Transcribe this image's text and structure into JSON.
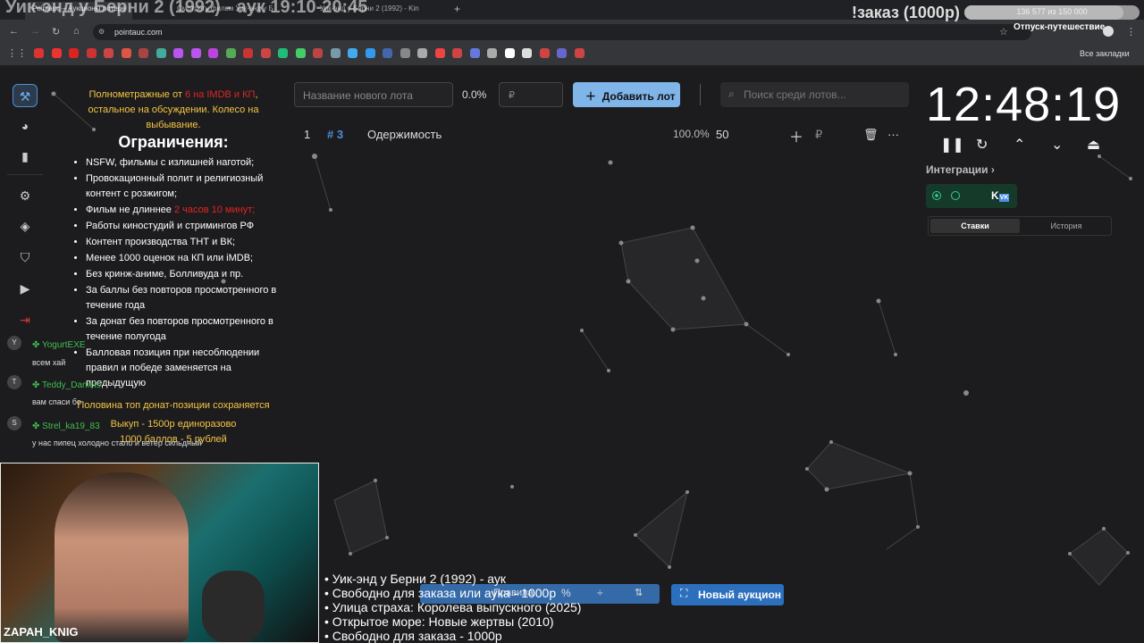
{
  "overlay": {
    "title": "Уик-энд у Берни 2 (1992) - аук 19:10-20:45",
    "order": "!заказ (1000р)",
    "progress": "136 577 из 150 000",
    "progress_fraction": 0.91,
    "vacation": "Отпуск-путешествие"
  },
  "browser": {
    "tabs": [
      "Pointauc – Аукционы лотере",
      "Смотреть фильм Уик-энд у Б",
      "Уик-энд у Берни 2 (1992) - Kin"
    ],
    "url": "pointauc.com",
    "all_bookmarks": "Все закладки",
    "bookmark_colors": [
      "#d33",
      "#e33",
      "#d22",
      "#c33",
      "#c44",
      "#d54",
      "#a44",
      "#4a9",
      "#b5e",
      "#b5e",
      "#b4d",
      "#5a5",
      "#c33",
      "#c44",
      "#2b7",
      "#4c6",
      "#b44",
      "#79a",
      "#4ae",
      "#39e",
      "#46a",
      "#888",
      "#aaa",
      "#e44",
      "#c44",
      "#67d",
      "#aaa",
      "#fff",
      "#ddd",
      "#c44",
      "#66c",
      "#c44"
    ]
  },
  "rules": {
    "note_prefix": "Полнометражные от ",
    "note_red": "6 на IMDB и КП",
    "note_suffix": ", остальное на обсуждении. Колесо на выбывание.",
    "heading": "Ограничения:",
    "items": [
      "NSFW, фильмы с излишней наготой;",
      "Провокационный полит и религиозный контент с розжигом;",
      "Фильм не длиннее ",
      "Работы киностудий и стримингов РФ",
      "Контент производства ТНТ и ВК;",
      "Менее 1000 оценок на КП или iMDB;",
      "Без кринж-аниме, Болливуда и пр.",
      "За баллы без повторов просмотренного в течение года",
      "За донат без повторов просмотренного в течение полугода",
      "Балловая позиция при несоблюдении правил и победе заменяется на предыдущую"
    ],
    "item3_red": "2 часов 10 минут;",
    "footer1": "Половина топ донат-позиции сохраняется",
    "footer2": "Выкуп - 1500р единоразово",
    "footer3": "1000 баллов - 5 рублей"
  },
  "controls": {
    "lot_placeholder": "Название нового лота",
    "pct": "0.0%",
    "currency": "₽",
    "add_lot": "Добавить лот",
    "search_placeholder": "Поиск среди лотов..."
  },
  "lot": {
    "index": "1",
    "id": "# 3",
    "name": "Одержимость",
    "pct": "100.0%",
    "amount": "50",
    "currency": "₽"
  },
  "timer": {
    "time": "12:48:19",
    "integrations": "Интеграции",
    "tab_bets": "Ставки",
    "tab_history": "История"
  },
  "chat": [
    {
      "initial": "Y",
      "name": "YogurtEXE",
      "msg": "всем хай"
    },
    {
      "initial": "T",
      "name": "Teddy_Daniels",
      "msg": "вам спаси бо"
    },
    {
      "initial": "S",
      "name": "Strel_ka19_83",
      "msg": "у нас пипец холодно стало и ветер сильдный"
    }
  ],
  "cam": {
    "name": "ZAPAH_KNIG"
  },
  "overlay_list": [
    "• Уик-энд у Берни 2 (1992) - аук",
    "• Свободно для заказа или аука - 1000р",
    "• Улица страха: Королева выпускного (2025)",
    "• Открытое море: Новые жертвы (2010)",
    "• Свободно для заказа - 1000р"
  ],
  "toolbar": {
    "rules": "Правила",
    "new_auction": "Новый аукцион"
  }
}
